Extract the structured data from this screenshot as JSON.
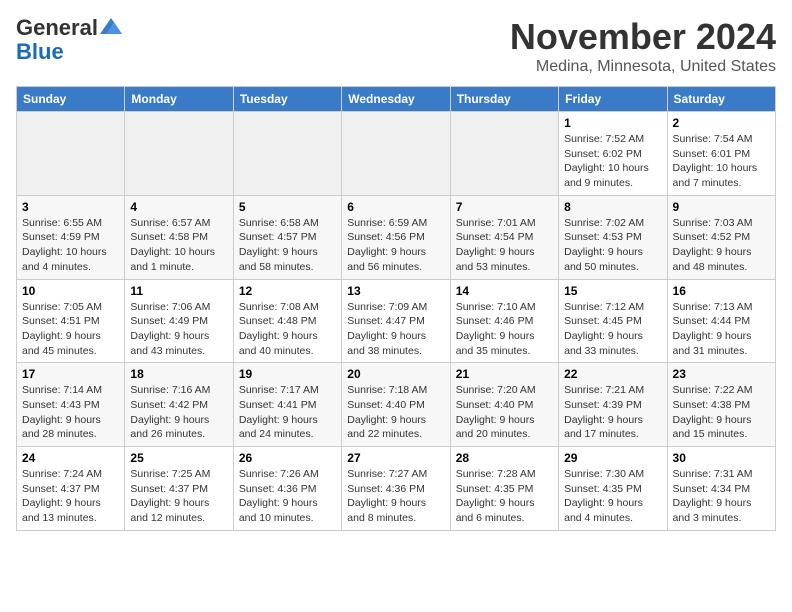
{
  "header": {
    "logo_general": "General",
    "logo_blue": "Blue",
    "month": "November 2024",
    "location": "Medina, Minnesota, United States"
  },
  "weekdays": [
    "Sunday",
    "Monday",
    "Tuesday",
    "Wednesday",
    "Thursday",
    "Friday",
    "Saturday"
  ],
  "weeks": [
    [
      {
        "day": "",
        "info": ""
      },
      {
        "day": "",
        "info": ""
      },
      {
        "day": "",
        "info": ""
      },
      {
        "day": "",
        "info": ""
      },
      {
        "day": "",
        "info": ""
      },
      {
        "day": "1",
        "info": "Sunrise: 7:52 AM\nSunset: 6:02 PM\nDaylight: 10 hours and 9 minutes."
      },
      {
        "day": "2",
        "info": "Sunrise: 7:54 AM\nSunset: 6:01 PM\nDaylight: 10 hours and 7 minutes."
      }
    ],
    [
      {
        "day": "3",
        "info": "Sunrise: 6:55 AM\nSunset: 4:59 PM\nDaylight: 10 hours and 4 minutes."
      },
      {
        "day": "4",
        "info": "Sunrise: 6:57 AM\nSunset: 4:58 PM\nDaylight: 10 hours and 1 minute."
      },
      {
        "day": "5",
        "info": "Sunrise: 6:58 AM\nSunset: 4:57 PM\nDaylight: 9 hours and 58 minutes."
      },
      {
        "day": "6",
        "info": "Sunrise: 6:59 AM\nSunset: 4:56 PM\nDaylight: 9 hours and 56 minutes."
      },
      {
        "day": "7",
        "info": "Sunrise: 7:01 AM\nSunset: 4:54 PM\nDaylight: 9 hours and 53 minutes."
      },
      {
        "day": "8",
        "info": "Sunrise: 7:02 AM\nSunset: 4:53 PM\nDaylight: 9 hours and 50 minutes."
      },
      {
        "day": "9",
        "info": "Sunrise: 7:03 AM\nSunset: 4:52 PM\nDaylight: 9 hours and 48 minutes."
      }
    ],
    [
      {
        "day": "10",
        "info": "Sunrise: 7:05 AM\nSunset: 4:51 PM\nDaylight: 9 hours and 45 minutes."
      },
      {
        "day": "11",
        "info": "Sunrise: 7:06 AM\nSunset: 4:49 PM\nDaylight: 9 hours and 43 minutes."
      },
      {
        "day": "12",
        "info": "Sunrise: 7:08 AM\nSunset: 4:48 PM\nDaylight: 9 hours and 40 minutes."
      },
      {
        "day": "13",
        "info": "Sunrise: 7:09 AM\nSunset: 4:47 PM\nDaylight: 9 hours and 38 minutes."
      },
      {
        "day": "14",
        "info": "Sunrise: 7:10 AM\nSunset: 4:46 PM\nDaylight: 9 hours and 35 minutes."
      },
      {
        "day": "15",
        "info": "Sunrise: 7:12 AM\nSunset: 4:45 PM\nDaylight: 9 hours and 33 minutes."
      },
      {
        "day": "16",
        "info": "Sunrise: 7:13 AM\nSunset: 4:44 PM\nDaylight: 9 hours and 31 minutes."
      }
    ],
    [
      {
        "day": "17",
        "info": "Sunrise: 7:14 AM\nSunset: 4:43 PM\nDaylight: 9 hours and 28 minutes."
      },
      {
        "day": "18",
        "info": "Sunrise: 7:16 AM\nSunset: 4:42 PM\nDaylight: 9 hours and 26 minutes."
      },
      {
        "day": "19",
        "info": "Sunrise: 7:17 AM\nSunset: 4:41 PM\nDaylight: 9 hours and 24 minutes."
      },
      {
        "day": "20",
        "info": "Sunrise: 7:18 AM\nSunset: 4:40 PM\nDaylight: 9 hours and 22 minutes."
      },
      {
        "day": "21",
        "info": "Sunrise: 7:20 AM\nSunset: 4:40 PM\nDaylight: 9 hours and 20 minutes."
      },
      {
        "day": "22",
        "info": "Sunrise: 7:21 AM\nSunset: 4:39 PM\nDaylight: 9 hours and 17 minutes."
      },
      {
        "day": "23",
        "info": "Sunrise: 7:22 AM\nSunset: 4:38 PM\nDaylight: 9 hours and 15 minutes."
      }
    ],
    [
      {
        "day": "24",
        "info": "Sunrise: 7:24 AM\nSunset: 4:37 PM\nDaylight: 9 hours and 13 minutes."
      },
      {
        "day": "25",
        "info": "Sunrise: 7:25 AM\nSunset: 4:37 PM\nDaylight: 9 hours and 12 minutes."
      },
      {
        "day": "26",
        "info": "Sunrise: 7:26 AM\nSunset: 4:36 PM\nDaylight: 9 hours and 10 minutes."
      },
      {
        "day": "27",
        "info": "Sunrise: 7:27 AM\nSunset: 4:36 PM\nDaylight: 9 hours and 8 minutes."
      },
      {
        "day": "28",
        "info": "Sunrise: 7:28 AM\nSunset: 4:35 PM\nDaylight: 9 hours and 6 minutes."
      },
      {
        "day": "29",
        "info": "Sunrise: 7:30 AM\nSunset: 4:35 PM\nDaylight: 9 hours and 4 minutes."
      },
      {
        "day": "30",
        "info": "Sunrise: 7:31 AM\nSunset: 4:34 PM\nDaylight: 9 hours and 3 minutes."
      }
    ]
  ]
}
